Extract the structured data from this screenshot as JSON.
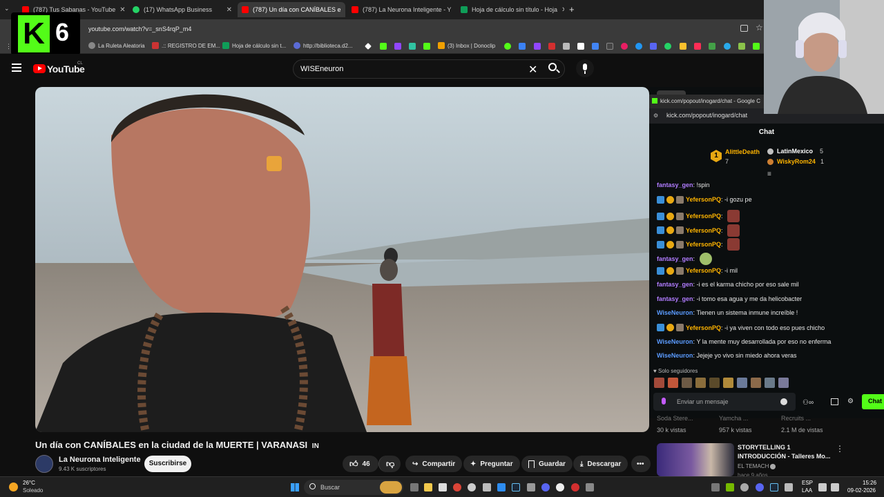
{
  "browser": {
    "tabs": [
      {
        "label": "(787) Tus Sabanas - YouTube",
        "favicon_color": "#ff0000"
      },
      {
        "label": "(17) WhatsApp Business",
        "favicon_color": "#25d366"
      },
      {
        "label": "(787) Un día con CANÍBALES e",
        "favicon_color": "#ff0000"
      },
      {
        "label": "(787) La Neurona Inteligente - Y",
        "favicon_color": "#ff0000"
      },
      {
        "label": "Hoja de cálculo sin título - Hoja",
        "favicon_color": "#0f9d58"
      }
    ],
    "new_tab_label": "+",
    "url": "youtube.com/watch?v=_snS4rqP_m4",
    "bookmarks": [
      {
        "label": "La Ruleta Aleatoria",
        "color": "#888888"
      },
      {
        "label": ".:: REGISTRO DE EM...",
        "color": "#cc3333"
      },
      {
        "label": "Hoja de cálculo sin t...",
        "color": "#0f9d58"
      },
      {
        "label": "http://biblioteca.d2...",
        "color": "#5b6bd6"
      },
      {
        "label": "(3) Inbox | Donoclip",
        "color": "#f0a000"
      }
    ]
  },
  "overlay": {
    "logo_letter": "K",
    "logo_number": "6",
    "logo_color": "#53fc18"
  },
  "youtube": {
    "logo_text": "YouTube",
    "country": "CL",
    "search_value": "WISEneuron",
    "video": {
      "title": "Un día con CANÍBALES en la ciudad de la MUERTE | VARANASI",
      "title_suffix": "IN",
      "channel": "La Neurona Inteligente",
      "subscribers": "9.43 K suscriptores",
      "subscribe_label": "Suscribirse",
      "likes": "46",
      "actions": {
        "share": "Compartir",
        "ask": "Preguntar",
        "save": "Guardar",
        "download": "Descargar"
      }
    },
    "recommended": [
      {
        "title": "Soda Stere...",
        "views": "30 k vistas"
      },
      {
        "title": "Yamcha ...",
        "views": "957 k vistas"
      },
      {
        "title": "Recruits ...",
        "views": "2.1 M de vistas"
      }
    ],
    "next_video": {
      "title_line1": "STORYTELLING 1",
      "title_line2": "INTRODUCCIÓN - Talleres Mo...",
      "channel": "EL TEMACH",
      "meta": "hace 9 años"
    }
  },
  "chat_window": {
    "window_title": "kick.com/popout/inogard/chat - Google C",
    "url": "kick.com/popout/inogard/chat",
    "header": "Chat",
    "leaderboard": [
      {
        "rank": "1",
        "name": "AlittleDeath",
        "count": "7"
      },
      {
        "rank": "",
        "name": "LatinMexico",
        "count": "5"
      },
      {
        "rank": "",
        "name": "WiskyRom24",
        "count": "1"
      }
    ],
    "messages": [
      {
        "user": "fantasy_gen",
        "text": "!spin",
        "color": "purple",
        "badges": false
      },
      {
        "user": "YefersonPQ",
        "text": "-i gozu pe",
        "color": "gold",
        "badges": true
      },
      {
        "user": "YefersonPQ",
        "text": "",
        "color": "gold",
        "badges": true,
        "emote": true
      },
      {
        "user": "YefersonPQ",
        "text": "",
        "color": "gold",
        "badges": true,
        "emote": true
      },
      {
        "user": "YefersonPQ",
        "text": "",
        "color": "gold",
        "badges": true,
        "emote": true
      },
      {
        "user": "fantasy_gen",
        "text": "",
        "color": "purple",
        "badges": false,
        "emote": true
      },
      {
        "user": "YefersonPQ",
        "text": "-i mil",
        "color": "gold",
        "badges": true
      },
      {
        "user": "fantasy_gen",
        "text": "-i es el karma chicho por eso sale mil",
        "color": "purple",
        "badges": false
      },
      {
        "user": "fantasy_gen",
        "text": "-i tomo esa agua y me da helicobacter",
        "color": "purple",
        "badges": false
      },
      {
        "user": "WiseNeuron",
        "text": "Tienen un sistema inmune increíble !",
        "color": "blue",
        "badges": false
      },
      {
        "user": "YefersonPQ",
        "text": "-i ya viven con todo eso pues chicho",
        "color": "gold",
        "badges": true
      },
      {
        "user": "WiseNeuron",
        "text": "Y la mente muy desarrollada por eso no enferma",
        "color": "blue",
        "badges": false
      },
      {
        "user": "WiseNeuron",
        "text": "Jejeje yo vivo sin miedo ahora veras",
        "color": "blue",
        "badges": false
      }
    ],
    "followers_only": "Solo seguidores",
    "input_placeholder": "Enviar un mensaje",
    "send_label": "Chat"
  },
  "taskbar": {
    "weather_temp": "26°C",
    "weather_desc": "Soleado",
    "search_label": "Buscar",
    "lang_line1": "ESP",
    "lang_line2": "LAA",
    "time": "15:26",
    "date": "09-02-2026"
  }
}
